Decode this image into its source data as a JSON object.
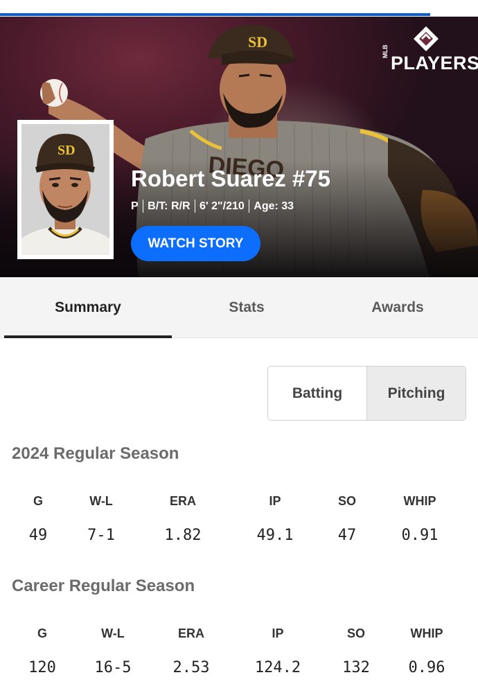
{
  "brand": {
    "logo_text": "PLAYERS",
    "logo_small": "MLB"
  },
  "player": {
    "name": "Robert Suarez #75",
    "position": "P",
    "bats_throws": "B/T: R/R",
    "height_weight": "6' 2\"/210",
    "age": "Age: 33",
    "watch_label": "WATCH STORY"
  },
  "story_progress": 0.9,
  "tabs": [
    {
      "label": "Summary",
      "active": true
    },
    {
      "label": "Stats",
      "active": false
    },
    {
      "label": "Awards",
      "active": false
    }
  ],
  "toggle": {
    "batting_label": "Batting",
    "pitching_label": "Pitching",
    "selected": "Pitching"
  },
  "seasons": [
    {
      "title": "2024 Regular Season",
      "headers": [
        "G",
        "W-L",
        "ERA",
        "IP",
        "SO",
        "WHIP"
      ],
      "values": [
        "49",
        "7-1",
        "1.82",
        "49.1",
        "47",
        "0.91"
      ]
    },
    {
      "title": "Career Regular Season",
      "headers": [
        "G",
        "W-L",
        "ERA",
        "IP",
        "SO",
        "WHIP"
      ],
      "values": [
        "120",
        "16-5",
        "2.53",
        "124.2",
        "132",
        "0.96"
      ]
    }
  ],
  "colors": {
    "accent": "#0d6efd",
    "progress": "#0a5bd6",
    "padres_brown": "#3b2a1e",
    "padres_gold": "#f2c230"
  }
}
